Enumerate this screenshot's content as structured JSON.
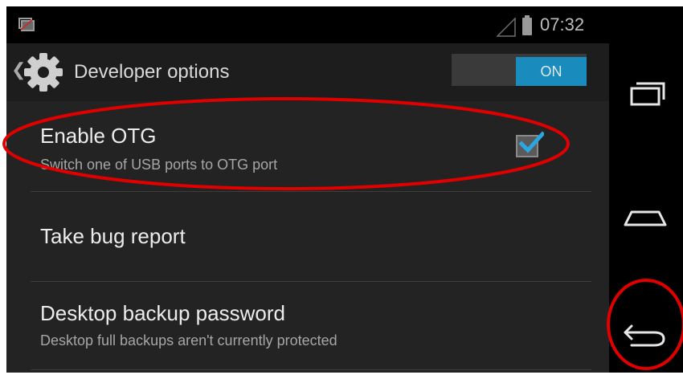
{
  "status_bar": {
    "notification_icon": "screenshot-notification-icon",
    "signal_icon": "signal-icon",
    "battery_icon": "battery-icon",
    "time": "07:32"
  },
  "action_bar": {
    "up_icon": "chevron-left-icon",
    "app_icon": "gear-icon",
    "title": "Developer options",
    "master_switch_label": "ON"
  },
  "preferences": [
    {
      "title": "Enable OTG",
      "summary": "Switch one of USB ports to OTG port",
      "checked": true
    },
    {
      "title": "Take bug report",
      "summary": ""
    },
    {
      "title": "Desktop backup password",
      "summary": "Desktop full backups aren't currently protected"
    }
  ],
  "nav_bar": {
    "recent_apps_icon": "recent-apps-icon",
    "home_icon": "home-icon",
    "back_icon": "back-icon"
  },
  "colors": {
    "background": "#232323",
    "accent": "#1a8bbd",
    "highlight_annotation": "#e00000"
  }
}
